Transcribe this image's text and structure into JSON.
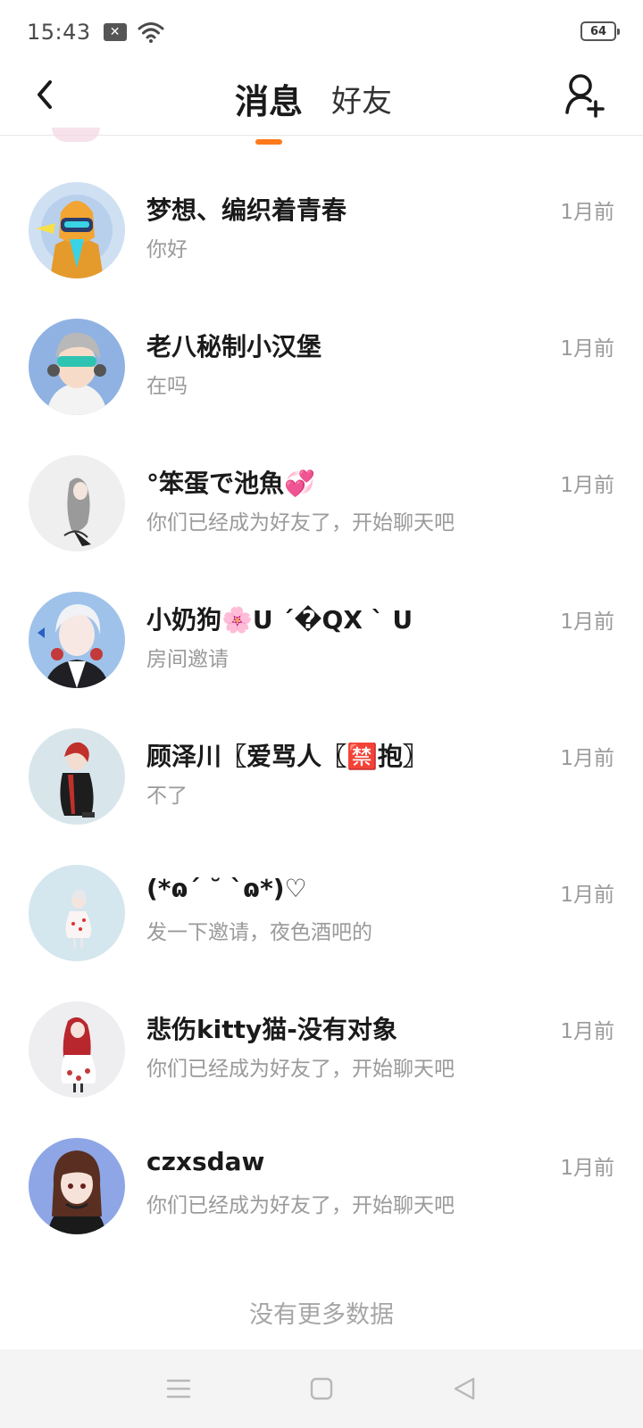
{
  "status_bar": {
    "time": "15:43",
    "battery": "64"
  },
  "header": {
    "tabs": [
      {
        "label": "消息",
        "active": true
      },
      {
        "label": "好友",
        "active": false
      }
    ]
  },
  "conversations": [
    {
      "name": "梦想、编织着青春",
      "preview": "你好",
      "time": "1月前"
    },
    {
      "name": "老八秘制小汉堡",
      "preview": "在吗",
      "time": "1月前"
    },
    {
      "name": "°笨蛋で池魚💞",
      "preview": "你们已经成为好友了，开始聊天吧",
      "time": "1月前"
    },
    {
      "name": "小奶狗🌸U ´�QX ` U",
      "preview": "房间邀请",
      "time": "1月前"
    },
    {
      "name": "顾泽川〖爱骂人〖🈲抱〗",
      "preview": "不了",
      "time": "1月前"
    },
    {
      "name": "(*ɷ´ ˘ `ɷ*)♡",
      "preview": "发一下邀请，夜色酒吧的",
      "time": "1月前"
    },
    {
      "name": "悲伤kitty猫-没有对象",
      "preview": "你们已经成为好友了，开始聊天吧",
      "time": "1月前"
    },
    {
      "name": "czxsdaw",
      "preview": "你们已经成为好友了，开始聊天吧",
      "time": "1月前"
    }
  ],
  "footer": {
    "no_more": "没有更多数据"
  },
  "colors": {
    "accent": "#ff7a1a",
    "secondary_text": "#9a9a9a"
  }
}
